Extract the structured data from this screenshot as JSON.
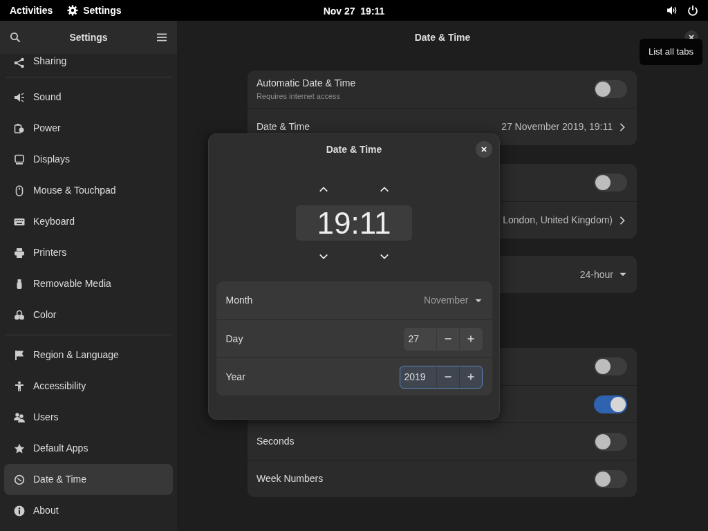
{
  "top_bar": {
    "activities": "Activities",
    "app": "Settings",
    "clock": "Nov 27  19:11"
  },
  "sidebar": {
    "title": "Settings",
    "groups": [
      [
        {
          "label": "Sharing",
          "selected": false
        }
      ],
      [
        {
          "label": "Sound",
          "selected": false
        },
        {
          "label": "Power",
          "selected": false
        },
        {
          "label": "Displays",
          "selected": false
        },
        {
          "label": "Mouse & Touchpad",
          "selected": false
        },
        {
          "label": "Keyboard",
          "selected": false
        },
        {
          "label": "Printers",
          "selected": false
        },
        {
          "label": "Removable Media",
          "selected": false
        },
        {
          "label": "Color",
          "selected": false
        }
      ],
      [
        {
          "label": "Region & Language",
          "selected": false
        },
        {
          "label": "Accessibility",
          "selected": false
        },
        {
          "label": "Users",
          "selected": false
        },
        {
          "label": "Default Apps",
          "selected": false
        },
        {
          "label": "Date & Time",
          "selected": true
        },
        {
          "label": "About",
          "selected": false
        }
      ]
    ]
  },
  "header": {
    "title": "Date & Time"
  },
  "tooltip": "List all tabs",
  "groups": [
    {
      "rows": [
        {
          "kind": "switch",
          "label": "Automatic Date & Time",
          "subtitle": "Requires internet access",
          "on": false
        },
        {
          "kind": "link",
          "label": "Date & Time",
          "value": "27 November 2019, 19:11"
        }
      ]
    },
    {
      "rows": [
        {
          "kind": "switch",
          "on": false
        },
        {
          "kind": "link",
          "value": "London, United Kingdom)"
        }
      ]
    },
    {
      "rows": [
        {
          "kind": "dropdown",
          "value": "24-hour"
        }
      ]
    },
    {
      "rows": [
        {
          "kind": "switch",
          "on": false
        },
        {
          "kind": "switch",
          "on": true
        },
        {
          "kind": "switch",
          "label": "Seconds",
          "on": false
        },
        {
          "kind": "switch",
          "label": "Week Numbers",
          "on": false
        }
      ]
    }
  ],
  "dialog": {
    "title": "Date & Time",
    "time": "19:11",
    "rows": [
      {
        "kind": "dropdown",
        "label": "Month",
        "value": "November"
      },
      {
        "kind": "spin",
        "label": "Day",
        "value": "27",
        "focused": false
      },
      {
        "kind": "spin",
        "label": "Year",
        "value": "2019",
        "focused": true
      }
    ]
  }
}
